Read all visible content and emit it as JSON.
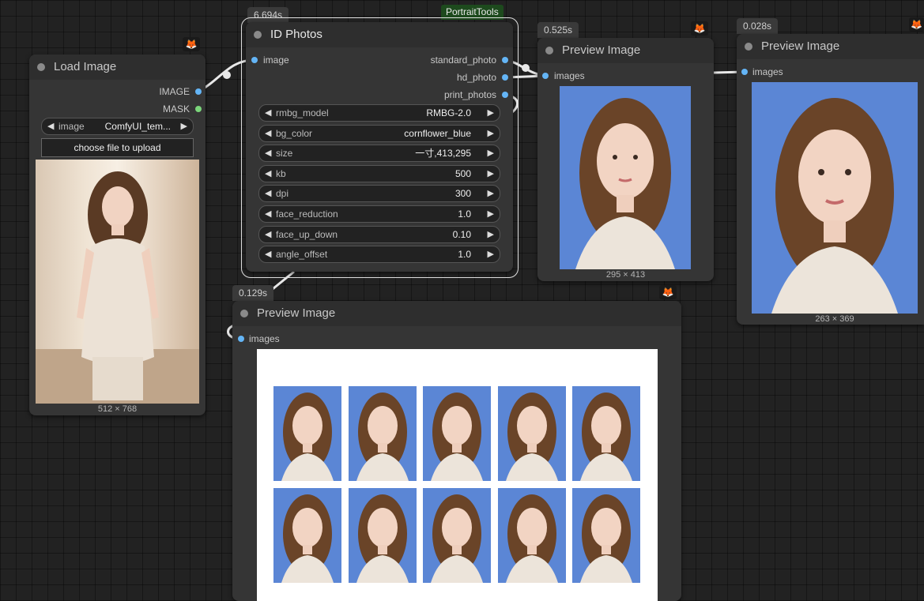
{
  "colors": {
    "canvas": "#222222",
    "node_body": "#353535",
    "node_title": "#2e2e2e",
    "slot_image": "#64b5f6",
    "slot_mask": "#7bd67b",
    "photo_background": "#5b86d5",
    "group_tag": "#1d4a1d"
  },
  "group": {
    "label": "PortraitTools"
  },
  "load_image": {
    "title": "Load Image",
    "outputs": [
      "IMAGE",
      "MASK"
    ],
    "image_widget": {
      "label": "image",
      "value": "ComfyUI_tem..."
    },
    "upload_label": "choose file to upload",
    "dimensions": "512 × 768",
    "icon": "fox-icon"
  },
  "id_photos": {
    "timing": "6.694s",
    "title": "ID Photos",
    "input": "image",
    "outputs": [
      "standard_photo",
      "hd_photo",
      "print_photos"
    ],
    "widgets": [
      {
        "label": "rmbg_model",
        "value": "RMBG-2.0"
      },
      {
        "label": "bg_color",
        "value": "cornflower_blue"
      },
      {
        "label": "size",
        "value": "一寸,413,295"
      },
      {
        "label": "kb",
        "value": "500"
      },
      {
        "label": "dpi",
        "value": "300"
      },
      {
        "label": "face_reduction",
        "value": "1.0"
      },
      {
        "label": "face_up_down",
        "value": "0.10"
      },
      {
        "label": "angle_offset",
        "value": "1.0"
      }
    ]
  },
  "preview_standard": {
    "timing": "0.525s",
    "title": "Preview Image",
    "input": "images",
    "dimensions": "295 × 413",
    "icon": "fox-icon"
  },
  "preview_hd": {
    "timing": "0.028s",
    "title": "Preview Image",
    "input": "images",
    "dimensions": "263 × 369",
    "icon": "fox-icon"
  },
  "preview_print": {
    "timing": "0.129s",
    "title": "Preview Image",
    "input": "images",
    "icon": "fox-icon",
    "grid": {
      "rows": 2,
      "cols": 5
    }
  }
}
